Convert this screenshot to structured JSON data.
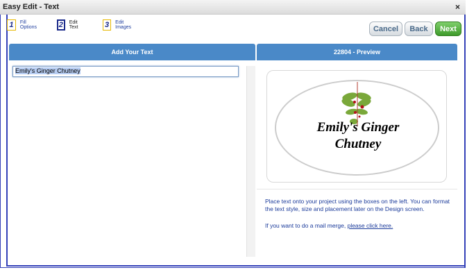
{
  "window": {
    "title": "Easy Edit - Text",
    "close_symbol": "×"
  },
  "steps": [
    {
      "number": "1",
      "label": "Fill Options"
    },
    {
      "number": "2",
      "label": "Edit Text"
    },
    {
      "number": "3",
      "label": "Edit Images"
    }
  ],
  "buttons": {
    "cancel": "Cancel",
    "back": "Back",
    "next": "Next"
  },
  "left": {
    "header": "Add Your Text",
    "input_value": "Emily's Ginger Chutney"
  },
  "right": {
    "header": "22804 -  Preview",
    "label_line1": "Emily's Ginger",
    "label_line2": "Chutney",
    "info_text": "Place text onto your project using the boxes on the left. You can format the text style, size and placement later on the Design screen.",
    "merge_prefix": "If you want to do a mail merge, ",
    "merge_link": "please click here."
  },
  "colors": {
    "header_blue": "#4a89c8",
    "next_green": "#3d9a2a",
    "border_blue": "#3340b8"
  }
}
